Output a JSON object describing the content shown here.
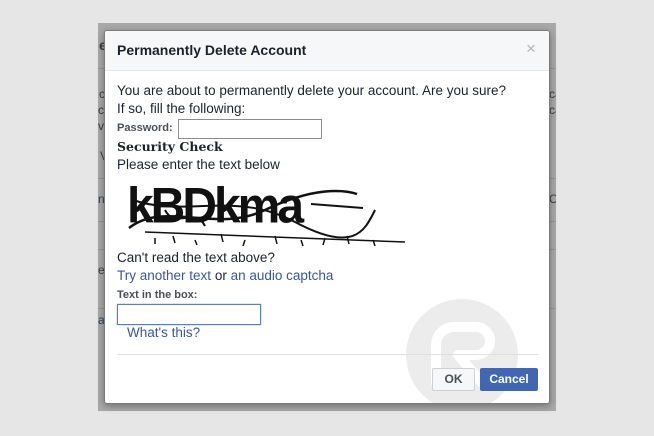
{
  "background_fragments": [
    "e",
    "c",
    "ca",
    "v",
    "V",
    "n",
    "C",
    "e",
    "a",
    "ca",
    "ca"
  ],
  "dialog": {
    "title": "Permanently Delete Account",
    "close_glyph": "×",
    "intro_line1": "You are about to permanently delete your account. Are you sure?",
    "intro_line2": "If so, fill the following:",
    "password_label": "Password:",
    "password_value": "",
    "security_heading": "Security Check",
    "captcha_prompt": "Please enter the text below",
    "captcha_text": "kBDkma",
    "cant_read": "Can't read the text above?",
    "try_another_link": "Try another text",
    "or_text": "or",
    "audio_link": "an audio captcha",
    "textbox_label": "Text in the box:",
    "textbox_value": "",
    "whats_this_link": "What's this?",
    "ok_label": "OK",
    "cancel_label": "Cancel"
  },
  "colors": {
    "link": "#365899",
    "primary_button": "#4267b2",
    "header_bg": "#f6f7f9",
    "overlay": "#8c8c8c"
  }
}
